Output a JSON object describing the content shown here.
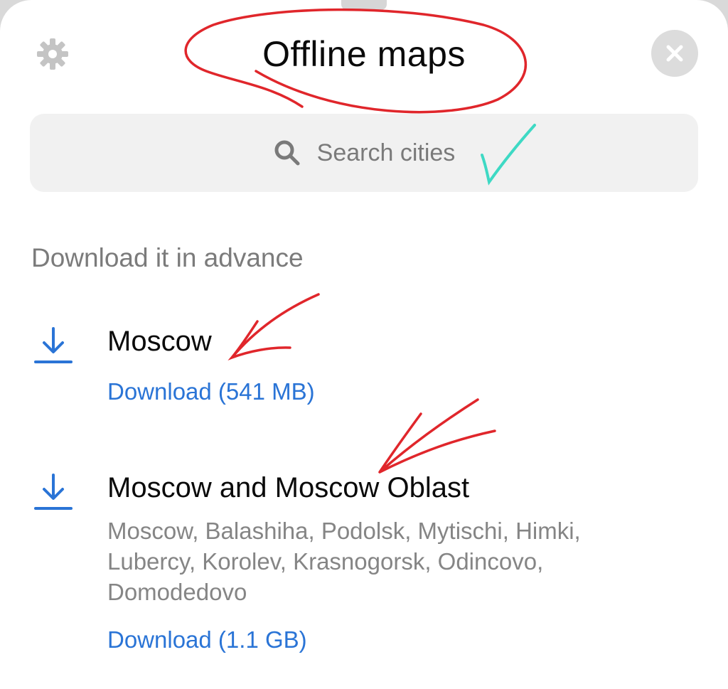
{
  "header": {
    "title": "Offline maps",
    "settings_icon": "gear-icon",
    "close_icon": "close-icon"
  },
  "search": {
    "placeholder": "Search cities",
    "icon": "search-icon"
  },
  "section": {
    "title": "Download it in advance"
  },
  "regions": [
    {
      "name": "Moscow",
      "description": "",
      "action": "Download (541 MB)",
      "icon": "download-icon"
    },
    {
      "name": "Moscow and Moscow Oblast",
      "description": "Moscow, Balashiha, Podolsk, Mytischi, Himki, Lubercy, Korolev, Krasnogorsk, Odincovo, Domodedovo",
      "action": "Download (1.1 GB)",
      "icon": "download-icon"
    }
  ],
  "colors": {
    "accent": "#2a74d6",
    "annotation_red": "#e0262b",
    "annotation_check": "#3ed9c4"
  }
}
